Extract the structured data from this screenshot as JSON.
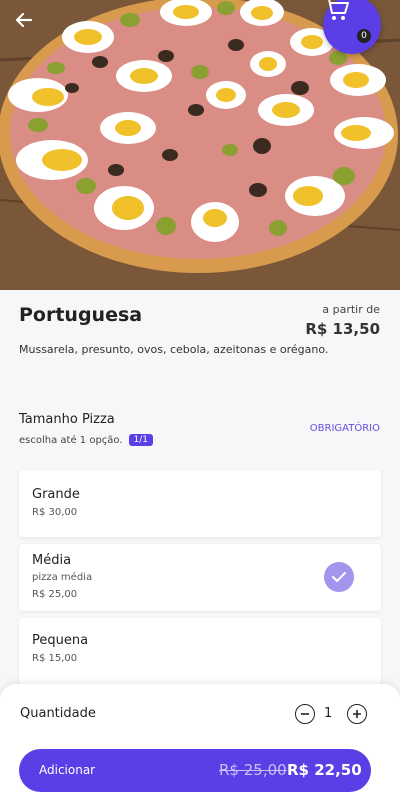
{
  "product": {
    "name": "Portuguesa",
    "from_label": "a partir de",
    "from_price": "R$ 13,50",
    "description": "Mussarela, presunto, ovos, cebola, azeitonas e orégano."
  },
  "cart": {
    "count": "0"
  },
  "section": {
    "title": "Tamanho Pizza",
    "subtitle": "escolha até 1 opção.",
    "counter": "1/1",
    "required": "OBRIGATÓRIO"
  },
  "options": [
    {
      "name": "Grande",
      "note": "",
      "price": "R$ 30,00",
      "selected": false
    },
    {
      "name": "Média",
      "note": "pizza média",
      "price": "R$ 25,00",
      "selected": true
    },
    {
      "name": "Pequena",
      "note": "",
      "price": "R$ 15,00",
      "selected": false
    }
  ],
  "footer": {
    "qty_label": "Quantidade",
    "qty_value": "1",
    "add_label": "Adicionar",
    "old_price": "R$ 25,00",
    "new_price": "R$ 22,50"
  },
  "colors": {
    "accent": "#5b3ee6",
    "check": "#a594ee"
  },
  "icons": [
    "arrow-left-icon",
    "cart-icon",
    "check-icon",
    "minus-icon",
    "plus-icon"
  ]
}
